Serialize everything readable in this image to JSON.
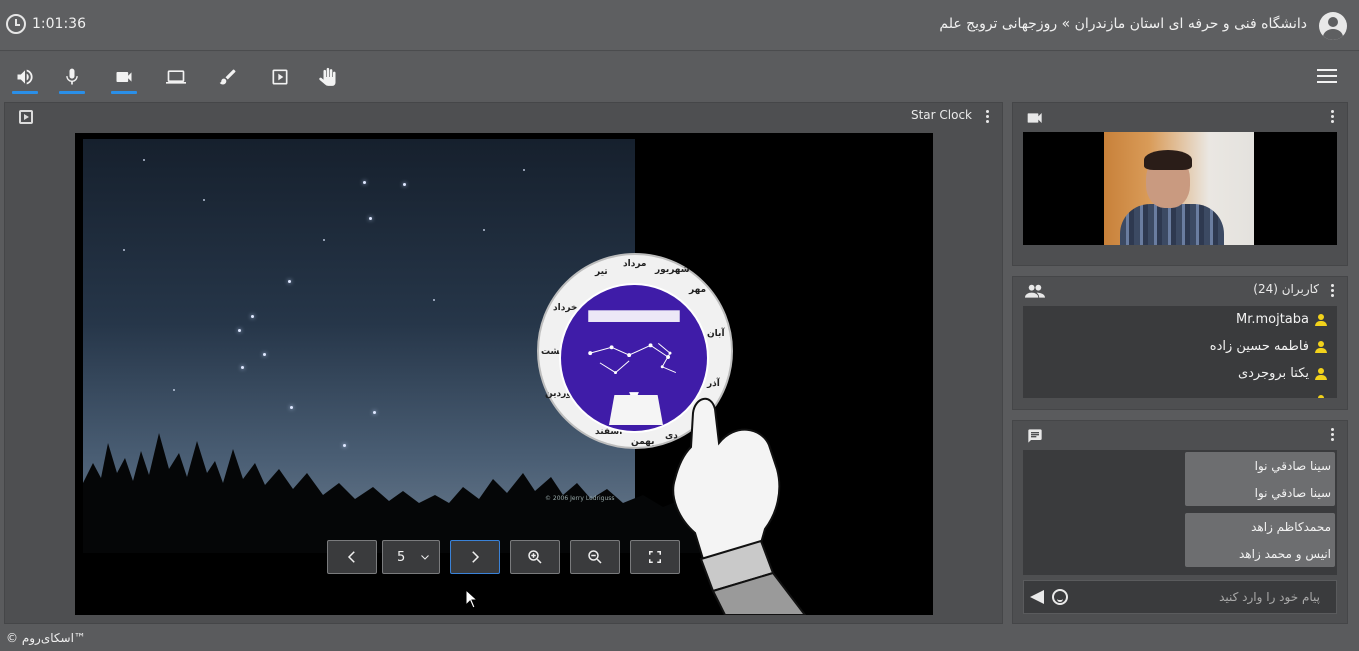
{
  "header": {
    "elapsed_time": "1:01:36",
    "room_title": "دانشگاه فنی و حرفه ای استان مازندران » روزجهانی ترویج علم"
  },
  "toolbar": {
    "tools": [
      "speaker-icon",
      "microphone-icon",
      "camera-icon",
      "screen-share-icon",
      "brush-icon",
      "presentation-icon",
      "raise-hand-icon"
    ],
    "active_underline_color": "#2a8fe8"
  },
  "presentation": {
    "title": "Star Clock",
    "slide_copyright": "© 2006 Jerry Lodriguss",
    "months": [
      "تیر",
      "مرداد",
      "شهریور",
      "مهر",
      "آبان",
      "آذر",
      "دی",
      "بهمن",
      "اسفند",
      "فروردین",
      "اردیبهشت",
      "خرداد"
    ],
    "current_page": "5",
    "controls": [
      "previous-icon",
      "next-icon",
      "zoom-in-icon",
      "zoom-out-icon",
      "fullscreen-icon"
    ]
  },
  "users": {
    "title": "کاربران (24)",
    "list": [
      "Mr.mojtaba",
      "فاطمه حسین زاده",
      "یکتا بروجردی",
      ""
    ]
  },
  "chat": {
    "messages": [
      {
        "lines": [
          "سینا صادقي نوا",
          "سینا صادقي نوا"
        ]
      },
      {
        "lines": [
          "محمدکاظم زاهد",
          "انیس و محمد زاهد"
        ]
      }
    ],
    "placeholder": "پیام خود را وارد کنید"
  },
  "footer": {
    "brand": "© اسکای‌روم™"
  }
}
